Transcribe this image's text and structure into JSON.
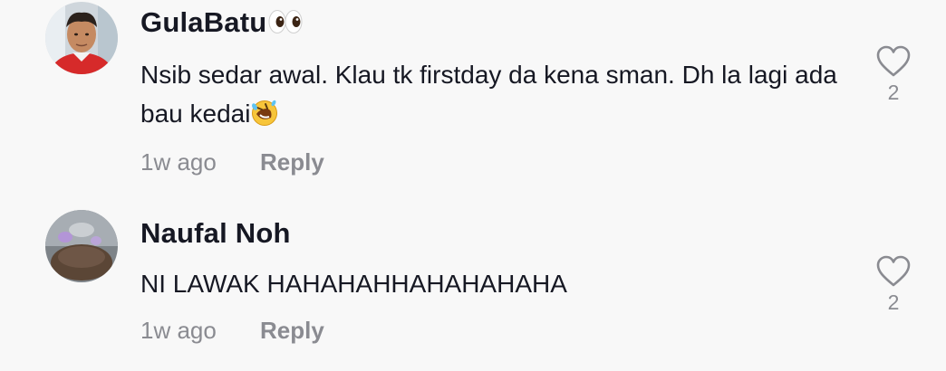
{
  "comments": [
    {
      "username": "GulaBatu",
      "username_emoji": "eyes",
      "text": "Nsib sedar awal. Klau tk firstday da kena sman. Dh la lagi ada bau kedai",
      "text_emoji": "rolling-on-the-floor-laughing",
      "time": "1w ago",
      "reply_label": "Reply",
      "likes": "2"
    },
    {
      "username": "Naufal Noh",
      "text": "NI LAWAK HAHAHAHHAHAHAHAHA",
      "time": "1w ago",
      "reply_label": "Reply",
      "likes": "2"
    }
  ],
  "colors": {
    "background": "#f8f8f8",
    "primary_text": "#161823",
    "secondary_text": "#8a8b91"
  }
}
